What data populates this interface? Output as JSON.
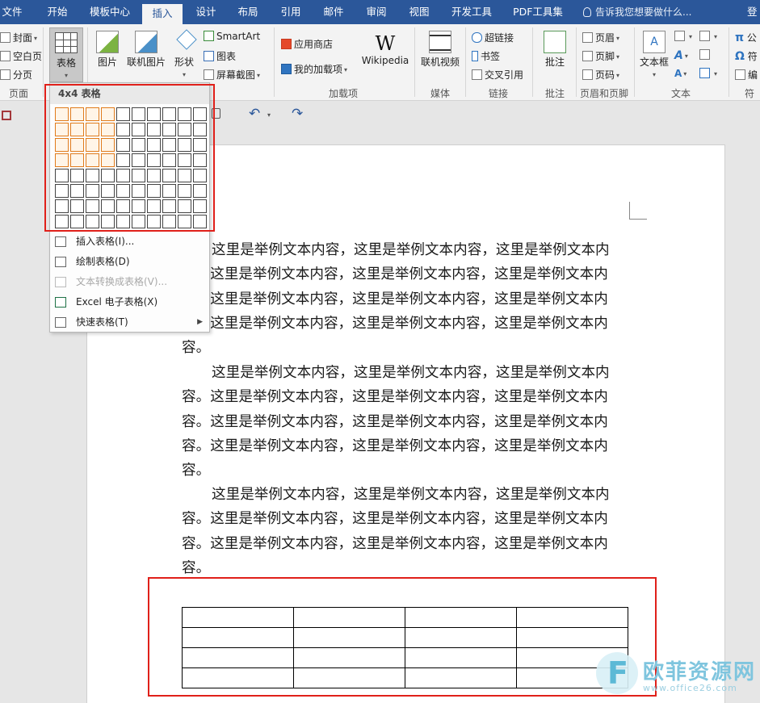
{
  "tabs": {
    "file": "文件",
    "home": "开始",
    "template": "模板中心",
    "insert": "插入",
    "design": "设计",
    "layout": "布局",
    "references": "引用",
    "mailings": "邮件",
    "review": "审阅",
    "view": "视图",
    "developer": "开发工具",
    "pdf": "PDF工具集",
    "tell_me": "告诉我您想要做什么...",
    "login": "登"
  },
  "ribbon": {
    "pages": {
      "cover": "封面",
      "blank": "空白页",
      "break": "分页",
      "group": "页面"
    },
    "table": {
      "label": "表格"
    },
    "illustrations": {
      "picture": "图片",
      "online_picture": "联机图片",
      "shapes": "形状",
      "smartart": "SmartArt",
      "chart": "图表",
      "screenshot": "屏幕截图"
    },
    "addins": {
      "store": "应用商店",
      "my_addins": "我的加载项",
      "wikipedia": "Wikipedia",
      "group": "加载项"
    },
    "media": {
      "online_video": "联机视频",
      "group": "媒体"
    },
    "links": {
      "hyperlink": "超链接",
      "bookmark": "书签",
      "cross_ref": "交叉引用",
      "group": "链接"
    },
    "comments": {
      "comment": "批注",
      "group": "批注"
    },
    "header_footer": {
      "header": "页眉",
      "footer": "页脚",
      "page_number": "页码",
      "group": "页眉和页脚"
    },
    "text": {
      "textbox": "文本框",
      "group": "文本"
    },
    "symbols": {
      "equation": "公",
      "symbol": "符",
      "number": "编",
      "group": "符"
    }
  },
  "table_menu": {
    "header": "4x4 表格",
    "rows": 8,
    "cols": 10,
    "selected_rows": 4,
    "selected_cols": 4,
    "items": [
      {
        "label": "插入表格(I)...",
        "disabled": false
      },
      {
        "label": "绘制表格(D)",
        "disabled": false
      },
      {
        "label": "文本转换成表格(V)...",
        "disabled": true
      },
      {
        "label": "Excel 电子表格(X)",
        "disabled": false
      },
      {
        "label": "快速表格(T)",
        "disabled": false
      }
    ]
  },
  "document": {
    "paragraphs": [
      [
        "这里是举例文本内容，这里是举例文本内容，这里是举例文本内",
        "容。这里是举例文本内容，这里是举例文本内容，这里是举例文本内",
        "容。这里是举例文本内容，这里是举例文本内容，这里是举例文本内",
        "容。这里是举例文本内容，这里是举例文本内容，这里是举例文本内",
        "容。"
      ],
      [
        "这里是举例文本内容，这里是举例文本内容，这里是举例文本内",
        "容。这里是举例文本内容，这里是举例文本内容，这里是举例文本内",
        "容。这里是举例文本内容，这里是举例文本内容，这里是举例文本内",
        "容。这里是举例文本内容，这里是举例文本内容，这里是举例文本内",
        "容。"
      ],
      [
        "这里是举例文本内容，这里是举例文本内容，这里是举例文本内",
        "容。这里是举例文本内容，这里是举例文本内容，这里是举例文本内",
        "容。这里是举例文本内容，这里是举例文本内容，这里是举例文本内",
        "容。"
      ]
    ],
    "table": {
      "rows": 4,
      "cols": 4
    }
  },
  "watermark": {
    "brand": "欧菲资源网",
    "url": "www.office26.com"
  },
  "colors": {
    "accent": "#2b579a",
    "highlight": "#e0201a",
    "grid_selected": "#e07b1b"
  }
}
